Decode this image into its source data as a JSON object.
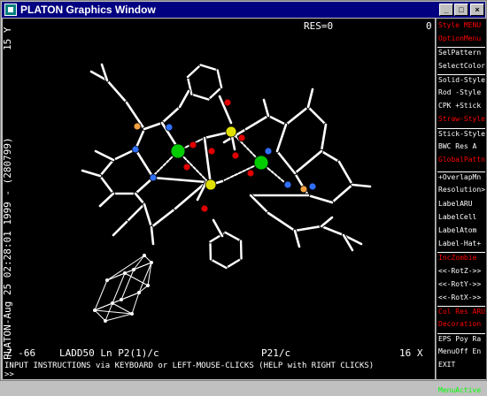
{
  "window": {
    "title": "PLATON Graphics Window"
  },
  "canvas": {
    "res_label": "RES=0",
    "corner_value": "0",
    "side_text": "PLATON-Aug 25 02:28:01 1999 - (280799)",
    "side_top": "15 Y",
    "bottom_left": "Z  -66",
    "bottom_name": "LADD50 Ln P2(1)/c",
    "bottom_spacegroup": "P21/c",
    "bottom_right": "16 X"
  },
  "menu": {
    "items": [
      {
        "label": "Style  MENU",
        "color": "#ff0000"
      },
      {
        "label": "OptionMenu",
        "color": "#ff0000"
      },
      {
        "label": "SelPattern",
        "color": "#ffffff"
      },
      {
        "label": "SelectColor",
        "color": "#ffffff"
      },
      {
        "label": "Solid-Style",
        "color": "#ffffff"
      },
      {
        "label": "Rod  -Style",
        "color": "#ffffff"
      },
      {
        "label": "CPK  +Stick",
        "color": "#ffffff"
      },
      {
        "label": "Straw-Style",
        "color": "#ff0000"
      },
      {
        "label": "Stick-Style",
        "color": "#ffffff"
      },
      {
        "label": "BWC Res A",
        "color": "#ffffff"
      },
      {
        "label": "GlobalPattn",
        "color": "#ff0000"
      },
      {
        "label": "+OverlapMn",
        "color": "#ffffff"
      },
      {
        "label": "Resolution>",
        "color": "#ffffff"
      },
      {
        "label": "LabelARU",
        "color": "#ffffff"
      },
      {
        "label": "LabelCell",
        "color": "#ffffff"
      },
      {
        "label": "LabelAtom",
        "color": "#ffffff"
      },
      {
        "label": "Label-Hat+",
        "color": "#ffffff"
      },
      {
        "label": "IncZombie",
        "color": "#ff0000"
      },
      {
        "label": "<<-RotZ->>",
        "color": "#ffffff"
      },
      {
        "label": "<<-RotY->>",
        "color": "#ffffff"
      },
      {
        "label": "<<-RotX->>",
        "color": "#ffffff"
      },
      {
        "label": "Col Res ARU",
        "color": "#ff0000"
      },
      {
        "label": "Decoration",
        "color": "#ff0000"
      },
      {
        "label": "EPS Poy Ra",
        "color": "#ffffff"
      },
      {
        "label": "MenuOff En",
        "color": "#ffffff"
      },
      {
        "label": "EXIT",
        "color": "#ffffff"
      },
      {
        "label": "MenuActive",
        "color": "#00ff00"
      }
    ]
  },
  "command": {
    "instructions": "INPUT INSTRUCTIONS via KEYBOARD or LEFT-MOUSE-CLICKS (HELP with RIGHT CLICKS)",
    "prompt": ">>"
  },
  "colors": {
    "title_bar": "#000080",
    "canvas_bg": "#000000",
    "metal": "#00cc00",
    "sulfur": "#e0e000",
    "oxygen": "#e00000",
    "nitrogen": "#3070ff",
    "phosphorus": "#f0a040",
    "carbon": "#ffffff"
  }
}
